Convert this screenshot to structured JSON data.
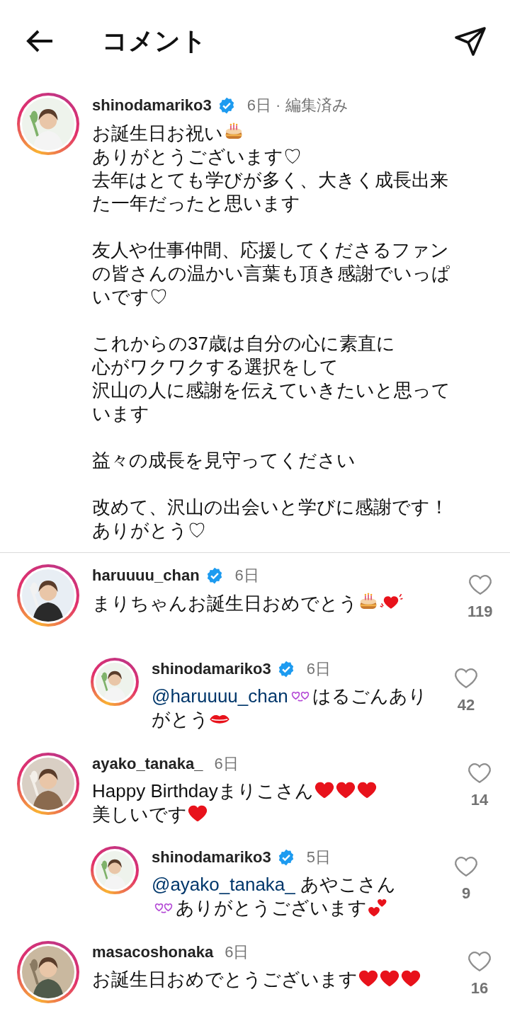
{
  "header": {
    "title": "コメント"
  },
  "caption": {
    "username": "shinodamariko3",
    "verified": true,
    "time": "6日 · 編集済み",
    "parts": [
      {
        "kind": "text",
        "text": "お誕生日お祝い"
      },
      {
        "kind": "cake"
      },
      {
        "kind": "text",
        "text": "\nありがとうございます♡\n去年はとても学びが多く、大きく成長出来た一年だったと思います"
      }
    ],
    "paragraphs": [
      [
        "友人や仕事仲間、応援してくださるファンの皆さんの温かい言葉も頂き感謝でいっぱいです♡"
      ],
      [
        "これからの37歳は自分の心に素直に",
        "心がワクワクする選択をして",
        "沢山の人に感謝を伝えていきたいと思っています"
      ],
      [
        "益々の成長を見守ってください"
      ],
      [
        "改めて、沢山の出会いと学びに感謝です！",
        "ありがとう♡"
      ]
    ]
  },
  "comments": [
    {
      "kind": "comment",
      "username": "haruuuu_chan",
      "verified": true,
      "time": "6日",
      "likes": "119",
      "parts": [
        {
          "kind": "text",
          "text": "まりちゃんお誕生日おめでとう"
        },
        {
          "kind": "cake"
        },
        {
          "kind": "beating-heart"
        }
      ]
    },
    {
      "kind": "reply",
      "username": "shinodamariko3",
      "verified": true,
      "time": "6日",
      "likes": "42",
      "parts": [
        {
          "kind": "mention",
          "text": "@haruuuu_chan"
        },
        {
          "kind": "purple-hearts"
        },
        {
          "kind": "text",
          "text": "はるごんありがとう"
        },
        {
          "kind": "lips"
        }
      ]
    },
    {
      "kind": "comment",
      "username": "ayako_tanaka_",
      "verified": false,
      "time": "6日",
      "likes": "14",
      "parts": [
        {
          "kind": "text",
          "text": "Happy Birthdayまりこさん"
        },
        {
          "kind": "heart"
        },
        {
          "kind": "heart"
        },
        {
          "kind": "heart"
        },
        {
          "kind": "text",
          "text": "\n美しいです"
        },
        {
          "kind": "heart"
        }
      ]
    },
    {
      "kind": "reply",
      "username": "shinodamariko3",
      "verified": true,
      "time": "5日",
      "likes": "9",
      "parts": [
        {
          "kind": "mention",
          "text": "@ayako_tanaka_"
        },
        {
          "kind": "text",
          "text": " あやこさん\n"
        },
        {
          "kind": "purple-hearts"
        },
        {
          "kind": "text",
          "text": "ありがとうございます"
        },
        {
          "kind": "two-hearts"
        }
      ]
    },
    {
      "kind": "comment",
      "username": "masacoshonaka",
      "verified": false,
      "time": "6日",
      "likes": "16",
      "parts": [
        {
          "kind": "text",
          "text": "お誕生日おめでとうございます"
        },
        {
          "kind": "heart"
        },
        {
          "kind": "heart"
        },
        {
          "kind": "heart"
        }
      ]
    }
  ]
}
